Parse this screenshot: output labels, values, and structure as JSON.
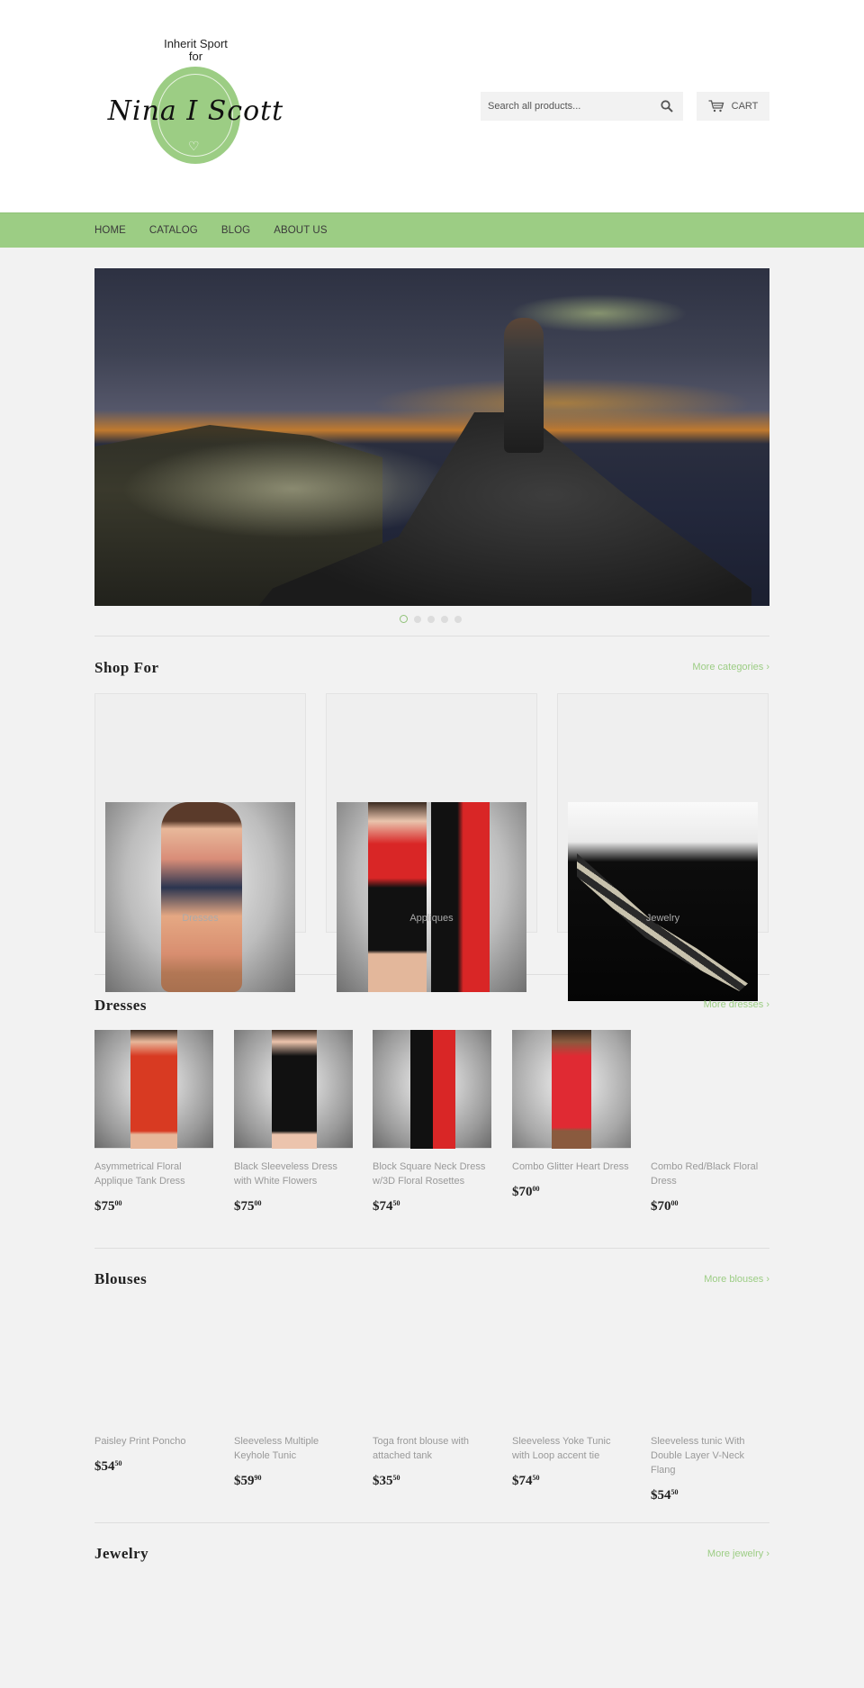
{
  "brand": {
    "tagline_line1": "Inherit Sport",
    "tagline_line2": "for",
    "script_name": "Nina I Scott",
    "accent_color": "#9ccd84"
  },
  "header": {
    "search_placeholder": "Search all products...",
    "search_icon": "search-icon",
    "cart_label": "CART",
    "cart_icon": "cart-icon"
  },
  "nav": {
    "items": [
      {
        "label": "HOME"
      },
      {
        "label": "CATALOG"
      },
      {
        "label": "BLOG"
      },
      {
        "label": "ABOUT US"
      }
    ]
  },
  "slideshow": {
    "slide_count": 5,
    "active_index": 0
  },
  "shop_for": {
    "title": "Shop For",
    "more_link": "More categories ›",
    "categories": [
      {
        "label": "Dresses"
      },
      {
        "label": "Appliques"
      },
      {
        "label": "Jewelry"
      }
    ]
  },
  "dresses": {
    "title": "Dresses",
    "more_link": "More dresses ›",
    "products": [
      {
        "title": "Asymmetrical Floral Applique Tank Dress",
        "price_main": "$75",
        "price_cents": "00"
      },
      {
        "title": "Black Sleeveless Dress with White Flowers",
        "price_main": "$75",
        "price_cents": "00"
      },
      {
        "title": "Block Square Neck Dress w/3D Floral Rosettes",
        "price_main": "$74",
        "price_cents": "50"
      },
      {
        "title": "Combo Glitter Heart Dress",
        "price_main": "$70",
        "price_cents": "00"
      },
      {
        "title": "Combo Red/Black Floral Dress",
        "price_main": "$70",
        "price_cents": "00"
      }
    ]
  },
  "blouses": {
    "title": "Blouses",
    "more_link": "More blouses ›",
    "products": [
      {
        "title": "Paisley Print Poncho",
        "price_main": "$54",
        "price_cents": "50"
      },
      {
        "title": "Sleeveless Multiple Keyhole Tunic",
        "price_main": "$59",
        "price_cents": "90"
      },
      {
        "title": "Toga front blouse with attached tank",
        "price_main": "$35",
        "price_cents": "50"
      },
      {
        "title": "Sleeveless Yoke Tunic with Loop accent tie",
        "price_main": "$74",
        "price_cents": "50"
      },
      {
        "title": "Sleeveless tunic With Double Layer V-Neck Flang",
        "price_main": "$54",
        "price_cents": "50"
      }
    ]
  },
  "jewelry": {
    "title": "Jewelry",
    "more_link": "More jewelry ›"
  }
}
